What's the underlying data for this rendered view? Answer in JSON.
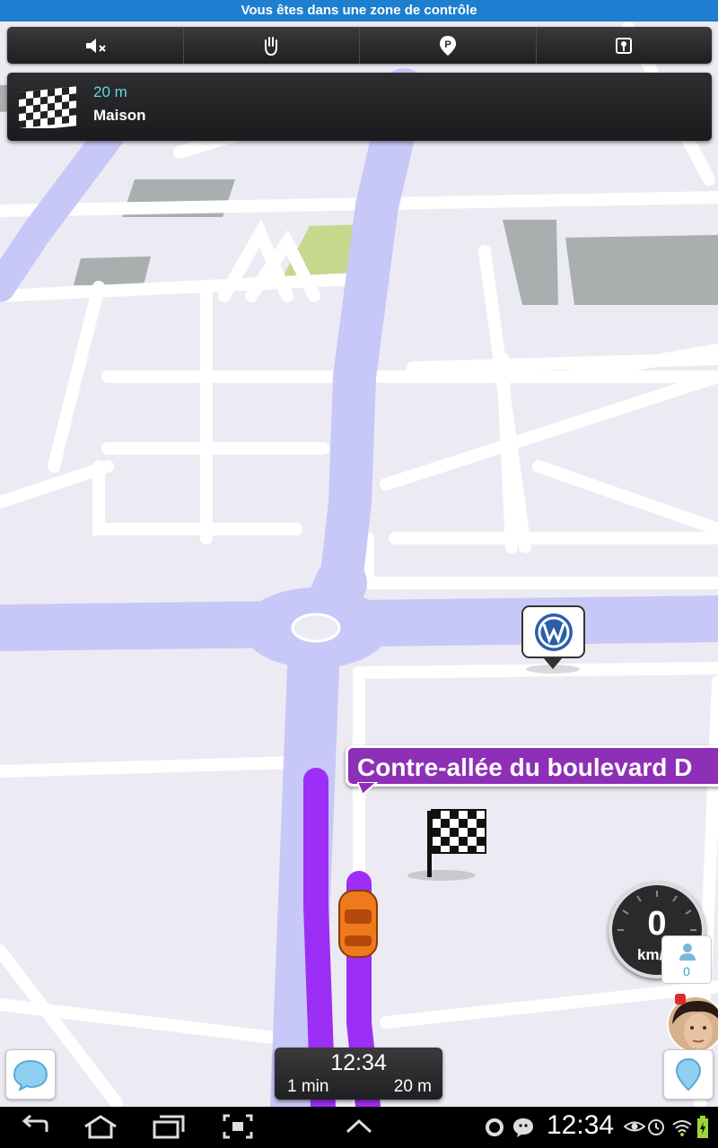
{
  "alert": {
    "text": "Vous êtes dans une zone de contrôle"
  },
  "toolbar": {
    "items": [
      {
        "icon": "mute-speaker-icon"
      },
      {
        "icon": "hand-icon"
      },
      {
        "icon": "parking-icon"
      },
      {
        "icon": "map-toggle-icon"
      }
    ]
  },
  "navigation": {
    "distance": "20 m",
    "destination": "Maison",
    "icon": "checkered-flag-icon"
  },
  "map": {
    "street_label": "Contre-allée du boulevard D",
    "poi_icon": "volkswagen-icon",
    "route_color": "#9d2ef5",
    "road_color": "#c7c7f8"
  },
  "speed": {
    "value": "0",
    "unit": "km/h"
  },
  "users": {
    "count": "0"
  },
  "eta": {
    "time": "12:34",
    "duration": "1 min",
    "distance": "20 m"
  },
  "status_bar": {
    "clock": "12:34"
  }
}
